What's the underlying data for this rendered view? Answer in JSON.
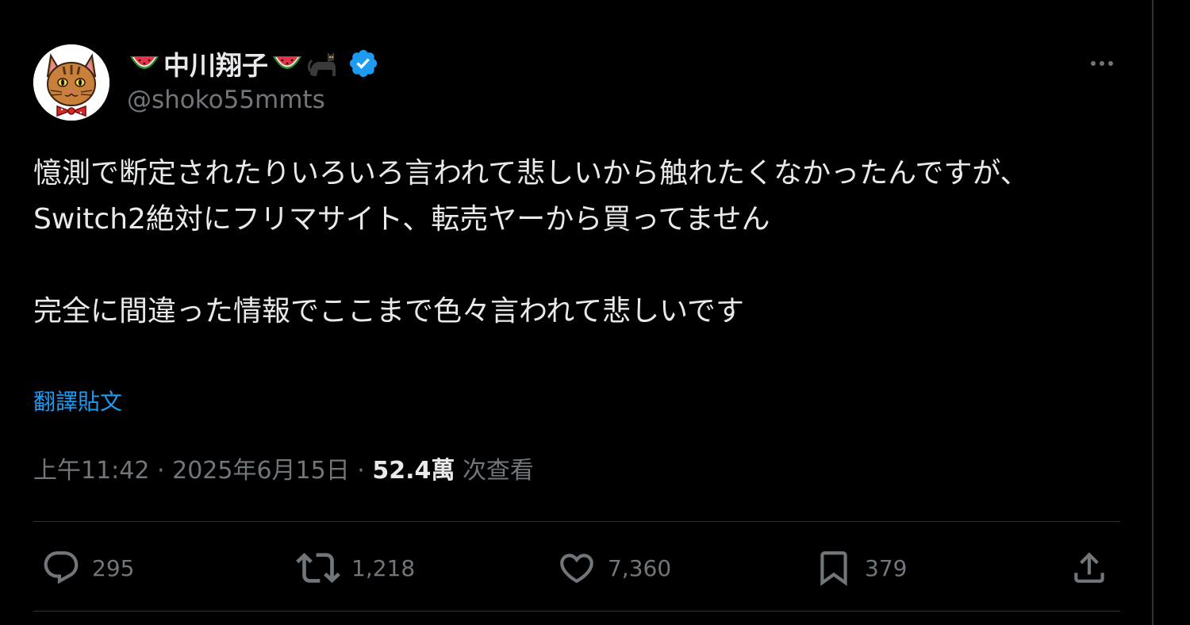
{
  "tweet": {
    "author": {
      "display_name": "中川翔子",
      "handle": "@shoko55mmts",
      "verified": true,
      "name_emojis": [
        "watermelon-icon",
        "watermelon-icon",
        "black-cat-icon"
      ]
    },
    "text": "憶測で断定されたりいろいろ言われて悲しいから触れたくなかったんですが、\nSwitch2絶対にフリマサイト、転売ヤーから買ってません\n\n完全に間違った情報でここまで色々言われて悲しいです",
    "translate_label": "翻譯貼文",
    "meta": {
      "time": "上午11:42",
      "separator": "·",
      "date": "2025年6月15日",
      "views_count": "52.4萬",
      "views_label": "次查看"
    },
    "stats": {
      "replies": "295",
      "retweets": "1,218",
      "likes": "7,360",
      "bookmarks": "379"
    }
  },
  "colors": {
    "background": "#000000",
    "text": "#e7e9ea",
    "muted": "#71767b",
    "link": "#1d9bf0",
    "divider": "#2f3336"
  }
}
